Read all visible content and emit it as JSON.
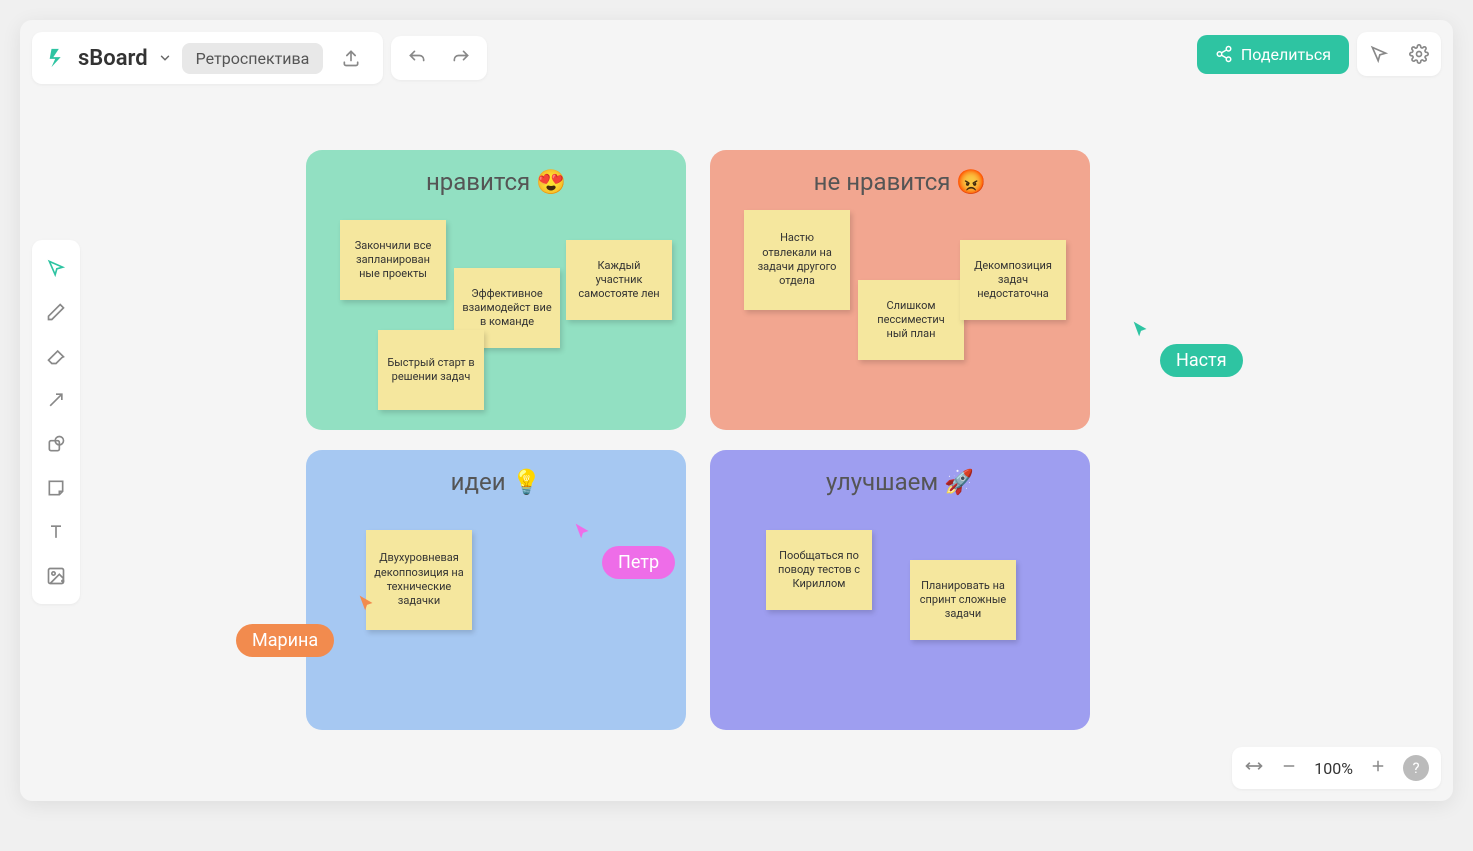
{
  "app": {
    "brand": "sBoard",
    "board_name": "Ретроспектива",
    "share_label": "Поделиться",
    "zoom_level": "100%"
  },
  "zones": {
    "like": {
      "title": "нравится 😍",
      "stickies": [
        "Закончили все запланирован ные проекты",
        "Эффективное взаимодейст вие в команде",
        "Каждый участник самостояте лен",
        "Быстрый старт в решении задач"
      ]
    },
    "dislike": {
      "title": "не нравится 😡",
      "stickies": [
        "Настю отвлекали на задачи другого отдела",
        "Слишком пессиместич ный план",
        "Декомпозиция задач недостаточна"
      ]
    },
    "ideas": {
      "title": "идеи 💡",
      "stickies": [
        "Двухуровневая декоппозиция на технические задачки"
      ]
    },
    "improve": {
      "title": "улучшаем 🚀",
      "stickies": [
        "Пообщаться по поводу тестов с Кириллом",
        "Планировать на спринт сложные задачи"
      ]
    }
  },
  "cursors": {
    "nastya": "Настя",
    "petr": "Петр",
    "marina": "Марина"
  }
}
